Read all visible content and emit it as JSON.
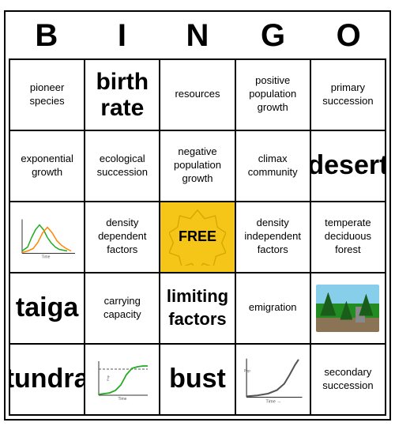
{
  "header": {
    "letters": [
      "B",
      "I",
      "N",
      "G",
      "O"
    ]
  },
  "cells": [
    {
      "id": "b1",
      "text": "pioneer species",
      "style": "normal"
    },
    {
      "id": "i1",
      "text": "birth rate",
      "style": "large"
    },
    {
      "id": "n1",
      "text": "resources",
      "style": "normal"
    },
    {
      "id": "g1",
      "text": "positive population growth",
      "style": "normal"
    },
    {
      "id": "o1",
      "text": "primary succession",
      "style": "normal"
    },
    {
      "id": "b2",
      "text": "exponential growth",
      "style": "normal"
    },
    {
      "id": "i2",
      "text": "ecological succession",
      "style": "normal"
    },
    {
      "id": "n2",
      "text": "negative population growth",
      "style": "normal"
    },
    {
      "id": "g2",
      "text": "climax community",
      "style": "normal"
    },
    {
      "id": "o2",
      "text": "desert",
      "style": "xlarge"
    },
    {
      "id": "b3",
      "text": "chart-boom-bust",
      "style": "chart"
    },
    {
      "id": "i3",
      "text": "density dependent factors",
      "style": "normal"
    },
    {
      "id": "n3",
      "text": "FREE",
      "style": "free"
    },
    {
      "id": "g3",
      "text": "density independent factors",
      "style": "normal"
    },
    {
      "id": "o3",
      "text": "temperate deciduous forest",
      "style": "normal"
    },
    {
      "id": "b4",
      "text": "taiga",
      "style": "xlarge"
    },
    {
      "id": "i4",
      "text": "carrying capacity",
      "style": "normal"
    },
    {
      "id": "n4",
      "text": "limiting factors",
      "style": "medium-large"
    },
    {
      "id": "g4",
      "text": "emigration",
      "style": "normal"
    },
    {
      "id": "o4",
      "text": "forest-image",
      "style": "image"
    },
    {
      "id": "b5",
      "text": "tundra",
      "style": "xlarge"
    },
    {
      "id": "i5",
      "text": "chart-s-curve",
      "style": "chart2"
    },
    {
      "id": "n5",
      "text": "bust",
      "style": "xlarge"
    },
    {
      "id": "g5",
      "text": "chart-j-curve",
      "style": "chart3"
    },
    {
      "id": "o5",
      "text": "secondary succession",
      "style": "normal"
    }
  ]
}
